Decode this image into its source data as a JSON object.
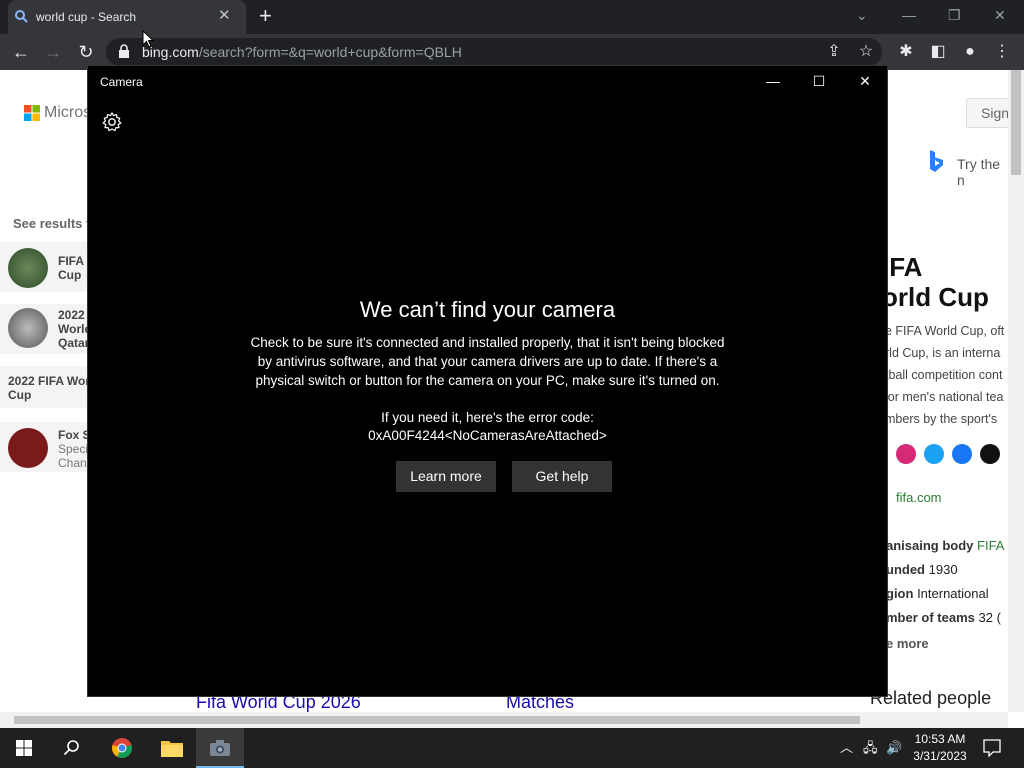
{
  "browser": {
    "tab_title": "world cup - Search",
    "url_host": "bing.com",
    "url_path": "/search?form=&q=world+cup&form=QBLH"
  },
  "page": {
    "microsoft_text": "Micros",
    "sign_in": "Sign",
    "try_text": "Try the n",
    "see_results": "See results f",
    "left_cards": [
      {
        "line1": "FIFA",
        "line2": "Cup"
      },
      {
        "line1": "2022",
        "line2": "World",
        "line3": "Qatar"
      },
      {
        "line1": "2022 FIFA Wor",
        "line2": "Cup"
      },
      {
        "line1": "Fox S",
        "line2": "Speci",
        "line3": "Chan"
      }
    ],
    "fifa_title_1": "IFA",
    "fifa_title_2": "orld Cup",
    "desc_lines": [
      "e FIFA World Cup, oft",
      "rld Cup, is an interna",
      "tball competition cont",
      "ior men's national tea",
      "mbers by the sport's"
    ],
    "fifa_link": "fifa.com",
    "facts": [
      {
        "label": "anisaing body",
        "value": "FIFA"
      },
      {
        "label": "unded",
        "value": "1930"
      },
      {
        "label": "gion",
        "value": "International"
      },
      {
        "label": "mber of teams",
        "value": "32 ("
      }
    ],
    "see_more": "e more",
    "bottom_link_1": "Fifa World Cup 2026",
    "bottom_link_2": "Matches",
    "related": "Related people"
  },
  "camera": {
    "title": "Camera",
    "heading": "We can’t find your camera",
    "body_lines": [
      "Check to be sure it's connected and installed properly, that it isn't being blocked",
      "by antivirus software, and that your camera drivers are up to date. If there's a",
      "physical switch or button for the camera on your PC, make sure it's turned on."
    ],
    "error_intro": "If you need it, here's the error code:",
    "error_code": "0xA00F4244<NoCamerasAreAttached>",
    "learn_more": "Learn more",
    "get_help": "Get help"
  },
  "taskbar": {
    "time": "10:53 AM",
    "date": "3/31/2023"
  },
  "colors": {
    "accent": "#76b9ed",
    "link": "#1a0dab"
  }
}
